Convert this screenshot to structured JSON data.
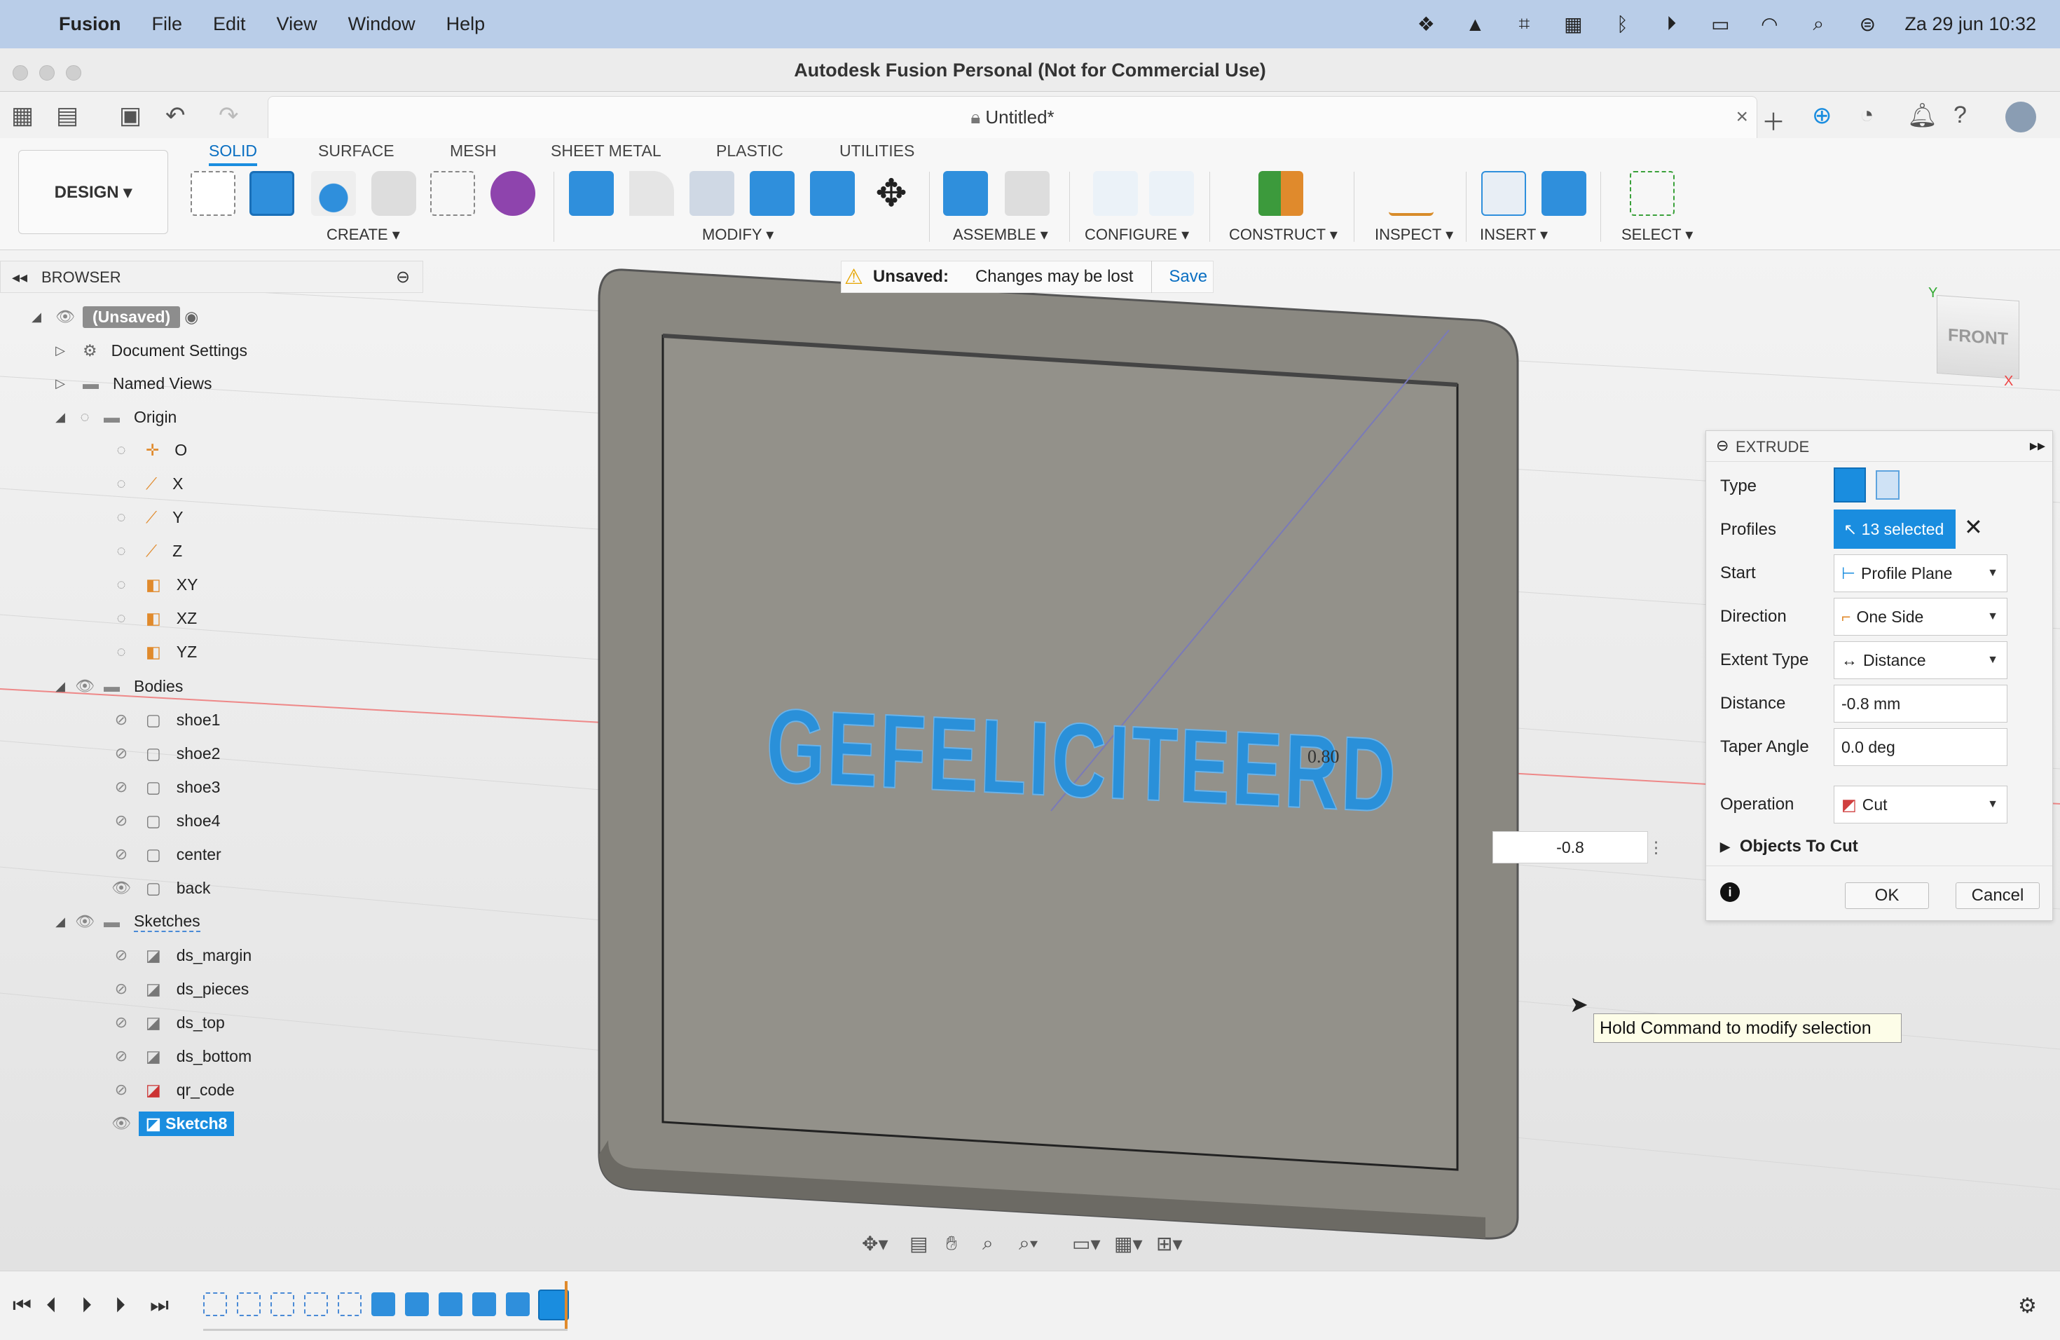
{
  "menubar": {
    "app": "Fusion",
    "items": [
      "File",
      "Edit",
      "View",
      "Window",
      "Help"
    ],
    "clock": "Za 29 jun  10:32"
  },
  "window": {
    "title": "Autodesk Fusion Personal (Not for Commercial Use)"
  },
  "document": {
    "tab_title": "Untitled*"
  },
  "ribbon": {
    "workspace": "DESIGN",
    "tabs": [
      "SOLID",
      "SURFACE",
      "MESH",
      "SHEET METAL",
      "PLASTIC",
      "UTILITIES"
    ],
    "active_tab": "SOLID",
    "groups": [
      "CREATE",
      "MODIFY",
      "ASSEMBLE",
      "CONFIGURE",
      "CONSTRUCT",
      "INSPECT",
      "INSERT",
      "SELECT"
    ]
  },
  "browser": {
    "title": "BROWSER",
    "root": "(Unsaved)",
    "items": {
      "document_settings": "Document Settings",
      "named_views": "Named Views",
      "origin": "Origin",
      "origin_children": [
        "O",
        "X",
        "Y",
        "Z",
        "XY",
        "XZ",
        "YZ"
      ],
      "bodies": "Bodies",
      "bodies_children": [
        "shoe1",
        "shoe2",
        "shoe3",
        "shoe4",
        "center",
        "back"
      ],
      "sketches": "Sketches",
      "sketches_children": [
        "ds_margin",
        "ds_pieces",
        "ds_top",
        "ds_bottom",
        "qr_code",
        "Sketch8"
      ]
    }
  },
  "unsaved_bar": {
    "label": "Unsaved:",
    "message": "Changes may be lost",
    "save": "Save"
  },
  "viewport": {
    "text_on_model": "GEFELICITEERD",
    "dimension_label": "0.80",
    "viewcube": "FRONT",
    "dimension_input": "-0.8"
  },
  "extrude": {
    "title": "EXTRUDE",
    "type_label": "Type",
    "profiles_label": "Profiles",
    "profiles_value": "13 selected",
    "start_label": "Start",
    "start_value": "Profile Plane",
    "direction_label": "Direction",
    "direction_value": "One Side",
    "extent_label": "Extent Type",
    "extent_value": "Distance",
    "distance_label": "Distance",
    "distance_value": "-0.8 mm",
    "taper_label": "Taper Angle",
    "taper_value": "0.0 deg",
    "operation_label": "Operation",
    "operation_value": "Cut",
    "objects_to_cut": "Objects To Cut",
    "ok": "OK",
    "cancel": "Cancel"
  },
  "tooltip": "Hold Command to modify selection",
  "colors": {
    "accent": "#1a8ddf",
    "model": "#8a8881",
    "text_3d": "#2a90d9",
    "menubar": "#b9cde8"
  }
}
